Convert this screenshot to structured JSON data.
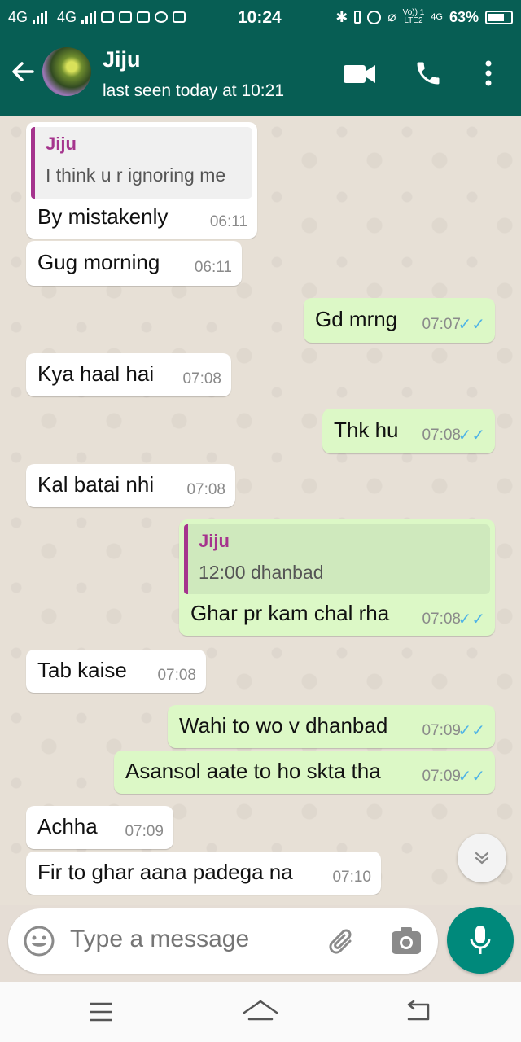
{
  "status_bar": {
    "network1": "4G",
    "network2": "4G",
    "time": "10:24",
    "volte": "Vo)) 1",
    "lte": "LTE2",
    "net_small": "4G",
    "battery": "63%"
  },
  "header": {
    "contact_name": "Jiju",
    "last_seen": "last seen today at 10:21"
  },
  "messages": [
    {
      "dir": "in",
      "text": "By mistakenly",
      "time": "06:11",
      "quote": {
        "name": "Jiju",
        "text": "I think u r ignoring me"
      }
    },
    {
      "dir": "in",
      "text": "Gug morning",
      "time": "06:11"
    },
    {
      "dir": "out",
      "text": "Gd mrng",
      "time": "07:07"
    },
    {
      "dir": "in",
      "text": "Kya haal hai",
      "time": "07:08"
    },
    {
      "dir": "out",
      "text": "Thk hu",
      "time": "07:08"
    },
    {
      "dir": "in",
      "text": "Kal batai nhi",
      "time": "07:08"
    },
    {
      "dir": "out",
      "text": "Ghar pr kam chal rha",
      "time": "07:08",
      "quote": {
        "name": "Jiju",
        "text": "12:00 dhanbad"
      }
    },
    {
      "dir": "in",
      "text": "Tab kaise",
      "time": "07:08"
    },
    {
      "dir": "out",
      "text": "Wahi to wo v dhanbad",
      "time": "07:09"
    },
    {
      "dir": "out",
      "text": "Asansol aate to ho skta tha",
      "time": "07:09"
    },
    {
      "dir": "in",
      "text": "Achha",
      "time": "07:09"
    },
    {
      "dir": "in",
      "text": "Fir to ghar aana padega na",
      "time": "07:10"
    }
  ],
  "composer": {
    "placeholder": "Type a message"
  },
  "icons": {
    "back": "arrow-back-icon",
    "video": "video-call-icon",
    "call": "phone-icon",
    "menu": "more-vert-icon",
    "emoji": "emoji-icon",
    "attach": "paperclip-icon",
    "camera": "camera-icon",
    "mic": "mic-icon",
    "scroll": "chevron-double-down-icon"
  },
  "colors": {
    "primary": "#075e54",
    "outgoing_bubble": "#dcf8c6",
    "incoming_bubble": "#ffffff",
    "quote_accent": "#a5348d",
    "read_ticks": "#4fb3e6",
    "mic_button": "#00897b"
  }
}
